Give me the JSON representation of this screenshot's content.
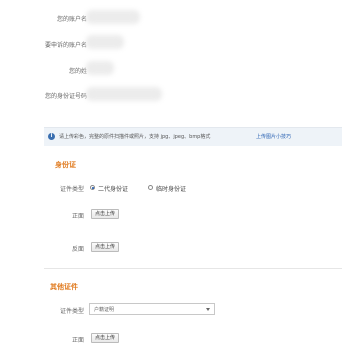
{
  "account_fields": {
    "account_label": "您的账户名",
    "appeal_account_label": "要申诉的账户名",
    "surname_label": "您的姓",
    "id_number_label": "您的身份证号码"
  },
  "tip": {
    "text": "请上传彩色，完整的原件扫描件或照片，支持 jpg、jpeg、bmp格式",
    "link": "上传图片小技巧"
  },
  "id_card_section": {
    "title": "身份证",
    "doc_type_label": "证件类型",
    "option_second_gen": "二代身份证",
    "option_temporary": "临时身份证",
    "selected": "二代身份证",
    "front_label": "正面",
    "back_label": "反面",
    "upload_button": "点击上传"
  },
  "other_section": {
    "title": "其他证件",
    "doc_type_label": "证件类型",
    "doc_type_value": "户籍证明",
    "front_label": "正面",
    "upload_button": "点击上传"
  },
  "colors": {
    "section_title": "#e07a1e",
    "link": "#2a62b3",
    "tip_background": "#eef3f8"
  }
}
